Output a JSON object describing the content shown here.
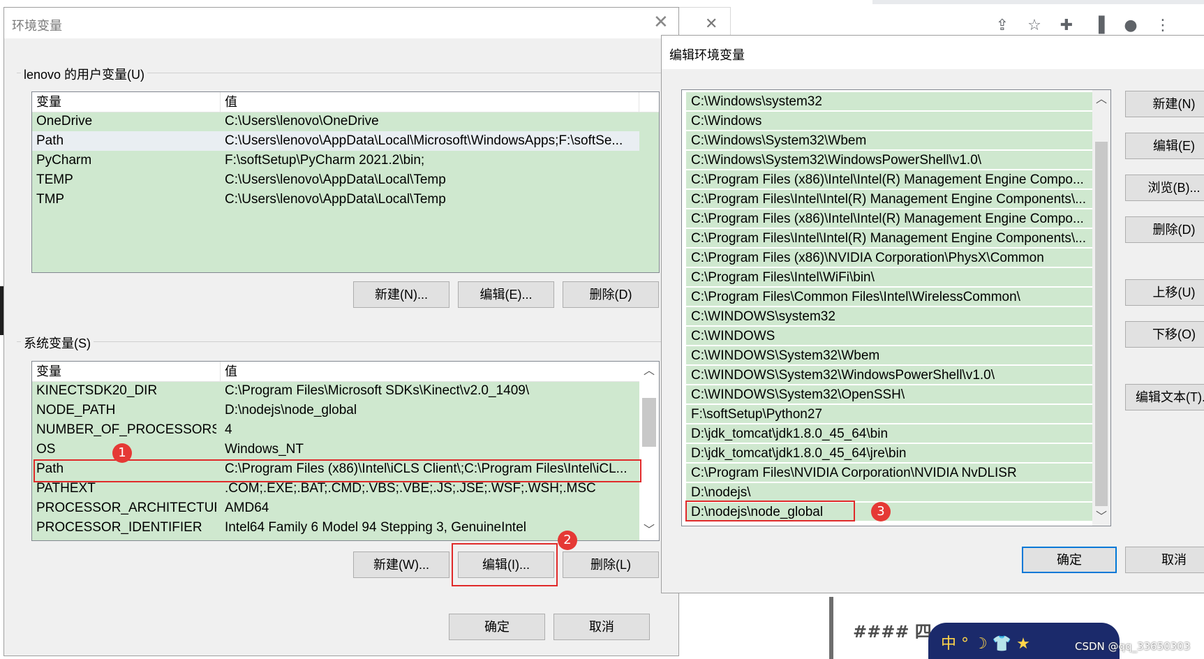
{
  "env_dialog": {
    "title": "环境变量",
    "user_group_label": "lenovo 的用户变量(U)",
    "system_group_label": "系统变量(S)",
    "col_name": "变量",
    "col_value": "值",
    "user_vars": [
      {
        "name": "OneDrive",
        "value": "C:\\Users\\lenovo\\OneDrive"
      },
      {
        "name": "Path",
        "value": "C:\\Users\\lenovo\\AppData\\Local\\Microsoft\\WindowsApps;F:\\softSe..."
      },
      {
        "name": "PyCharm",
        "value": "F:\\softSetup\\PyCharm 2021.2\\bin;"
      },
      {
        "name": "TEMP",
        "value": "C:\\Users\\lenovo\\AppData\\Local\\Temp"
      },
      {
        "name": "TMP",
        "value": "C:\\Users\\lenovo\\AppData\\Local\\Temp"
      }
    ],
    "user_buttons": {
      "new": "新建(N)...",
      "edit": "编辑(E)...",
      "delete": "删除(D)"
    },
    "system_vars": [
      {
        "name": "KINECTSDK20_DIR",
        "value": "C:\\Program Files\\Microsoft SDKs\\Kinect\\v2.0_1409\\"
      },
      {
        "name": "NODE_PATH",
        "value": "D:\\nodejs\\node_global"
      },
      {
        "name": "NUMBER_OF_PROCESSORS",
        "value": "4"
      },
      {
        "name": "OS",
        "value": "Windows_NT"
      },
      {
        "name": "Path",
        "value": "C:\\Program Files (x86)\\Intel\\iCLS Client\\;C:\\Program Files\\Intel\\iCL..."
      },
      {
        "name": "PATHEXT",
        "value": ".COM;.EXE;.BAT;.CMD;.VBS;.VBE;.JS;.JSE;.WSF;.WSH;.MSC"
      },
      {
        "name": "PROCESSOR_ARCHITECTURE",
        "value": "AMD64"
      },
      {
        "name": "PROCESSOR_IDENTIFIER",
        "value": "Intel64 Family 6 Model 94 Stepping 3, GenuineIntel"
      }
    ],
    "system_buttons": {
      "new": "新建(W)...",
      "edit": "编辑(I)...",
      "delete": "删除(L)"
    },
    "ok": "确定",
    "cancel": "取消"
  },
  "edit_dialog": {
    "title": "编辑环境变量",
    "entries": [
      "C:\\Windows\\system32",
      "C:\\Windows",
      "C:\\Windows\\System32\\Wbem",
      "C:\\Windows\\System32\\WindowsPowerShell\\v1.0\\",
      "C:\\Program Files (x86)\\Intel\\Intel(R) Management Engine Compo...",
      "C:\\Program Files\\Intel\\Intel(R) Management Engine Components\\...",
      "C:\\Program Files (x86)\\Intel\\Intel(R) Management Engine Compo...",
      "C:\\Program Files\\Intel\\Intel(R) Management Engine Components\\...",
      "C:\\Program Files (x86)\\NVIDIA Corporation\\PhysX\\Common",
      "C:\\Program Files\\Intel\\WiFi\\bin\\",
      "C:\\Program Files\\Common Files\\Intel\\WirelessCommon\\",
      "C:\\WINDOWS\\system32",
      "C:\\WINDOWS",
      "C:\\WINDOWS\\System32\\Wbem",
      "C:\\WINDOWS\\System32\\WindowsPowerShell\\v1.0\\",
      "C:\\WINDOWS\\System32\\OpenSSH\\",
      "F:\\softSetup\\Python27",
      "D:\\jdk_tomcat\\jdk1.8.0_45_64\\bin",
      "D:\\jdk_tomcat\\jdk1.8.0_45_64\\jre\\bin",
      "C:\\Program Files\\NVIDIA Corporation\\NVIDIA NvDLISR",
      "D:\\nodejs\\",
      "D:\\nodejs\\node_global"
    ],
    "buttons": {
      "new": "新建(N)",
      "edit": "编辑(E)",
      "browse": "浏览(B)...",
      "delete": "删除(D)",
      "move_up": "上移(U)",
      "move_down": "下移(O)",
      "edit_text": "编辑文本(T)..."
    },
    "ok": "确定",
    "cancel": "取消"
  },
  "annotations": {
    "step1": "1",
    "step2": "2",
    "step3": "3"
  },
  "background": {
    "article_heading": "#### 四",
    "ad_text": "中 ° ☽ 👕 ★",
    "watermark": "CSDN @qq_33650303"
  },
  "browser_icons": [
    "share-icon",
    "star-icon",
    "extensions-icon",
    "sidepanel-icon",
    "profile-icon",
    "menu-icon"
  ],
  "colors": {
    "list_bg": "#cfe8cf",
    "selection_box": "#e02a2a",
    "badge": "#e53935",
    "primary_border": "#0078d7"
  }
}
